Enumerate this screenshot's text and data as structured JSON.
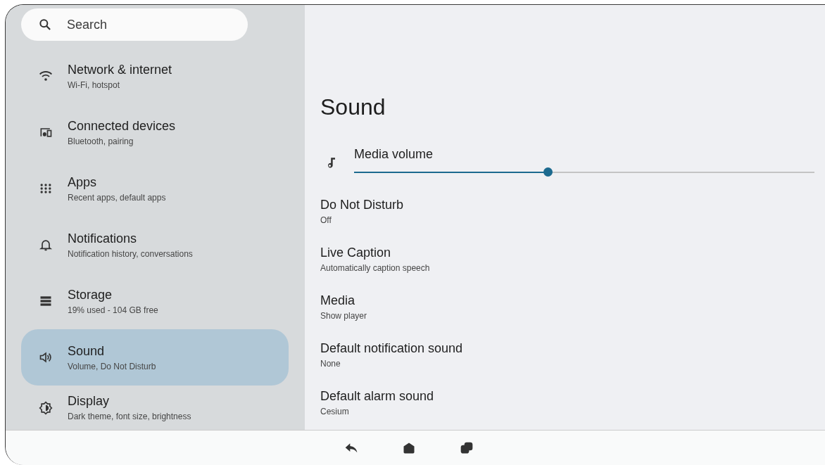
{
  "search": {
    "placeholder": "Search"
  },
  "nav_items": [
    {
      "kind": "wifi",
      "title": "Network & internet",
      "subtitle": "Wi-Fi, hotspot",
      "selected": false
    },
    {
      "kind": "devices",
      "title": "Connected devices",
      "subtitle": "Bluetooth, pairing",
      "selected": false
    },
    {
      "kind": "apps",
      "title": "Apps",
      "subtitle": "Recent apps, default apps",
      "selected": false
    },
    {
      "kind": "bell",
      "title": "Notifications",
      "subtitle": "Notification history, conversations",
      "selected": false
    },
    {
      "kind": "storage",
      "title": "Storage",
      "subtitle": "19% used - 104 GB free",
      "selected": false
    },
    {
      "kind": "sound",
      "title": "Sound",
      "subtitle": "Volume, Do Not Disturb",
      "selected": true
    },
    {
      "kind": "display",
      "title": "Display",
      "subtitle": "Dark theme, font size, brightness",
      "selected": false
    }
  ],
  "page": {
    "title": "Sound"
  },
  "settings": [
    {
      "kind": "slider",
      "title": "Media volume",
      "level": 0.42
    },
    {
      "kind": "item",
      "title": "Do Not Disturb",
      "subtitle": "Off"
    },
    {
      "kind": "item",
      "title": "Live Caption",
      "subtitle": "Automatically caption speech"
    },
    {
      "kind": "item",
      "title": "Media",
      "subtitle": "Show player"
    },
    {
      "kind": "item",
      "title": "Default notification sound",
      "subtitle": "None"
    },
    {
      "kind": "item",
      "title": "Default alarm sound",
      "subtitle": "Cesium"
    }
  ],
  "nav_bar": [
    {
      "kind": "back"
    },
    {
      "kind": "home"
    },
    {
      "kind": "recents"
    }
  ]
}
